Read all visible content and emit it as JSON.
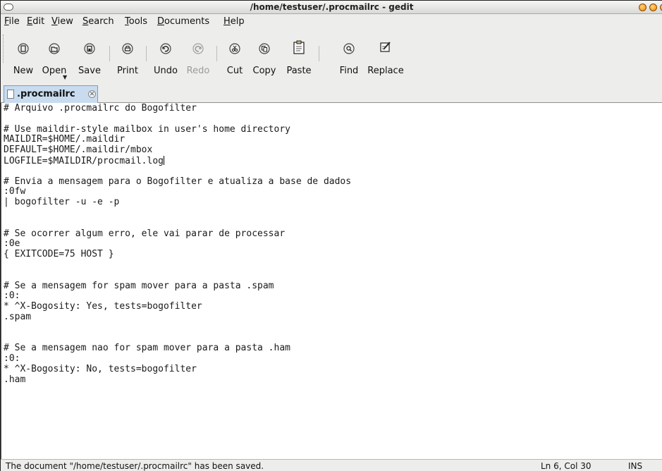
{
  "window": {
    "title": "/home/testuser/.procmailrc - gedit"
  },
  "menubar": {
    "items": [
      {
        "label": "File"
      },
      {
        "label": "Edit"
      },
      {
        "label": "View"
      },
      {
        "label": "Search"
      },
      {
        "label": "Tools"
      },
      {
        "label": "Documents"
      },
      {
        "label": "Help"
      }
    ]
  },
  "toolbar": {
    "buttons": [
      {
        "label": "New",
        "icon": "new-document-icon",
        "enabled": true
      },
      {
        "label": "Open",
        "icon": "open-folder-icon",
        "enabled": true
      },
      {
        "label": "Save",
        "icon": "save-disk-icon",
        "enabled": true
      },
      {
        "label": "Print",
        "icon": "printer-icon",
        "enabled": true
      },
      {
        "label": "Undo",
        "icon": "undo-icon",
        "enabled": true
      },
      {
        "label": "Redo",
        "icon": "redo-icon",
        "enabled": false
      },
      {
        "label": "Cut",
        "icon": "scissors-icon",
        "enabled": true
      },
      {
        "label": "Copy",
        "icon": "copy-icon",
        "enabled": true
      },
      {
        "label": "Paste",
        "icon": "clipboard-icon",
        "enabled": true
      },
      {
        "label": "Find",
        "icon": "magnifier-icon",
        "enabled": true
      },
      {
        "label": "Replace",
        "icon": "replace-icon",
        "enabled": true
      }
    ]
  },
  "tabs": [
    {
      "label": ".procmailrc",
      "active": true
    }
  ],
  "editor": {
    "lines": [
      "# Arquivo .procmailrc do Bogofilter",
      "",
      "# Use maildir-style mailbox in user's home directory",
      "MAILDIR=$HOME/.maildir",
      "DEFAULT=$HOME/.maildir/mbox",
      "LOGFILE=$MAILDIR/procmail.log",
      "",
      "# Envia a mensagem para o Bogofilter e atualiza a base de dados",
      ":0fw",
      "| bogofilter -u -e -p",
      "",
      "",
      "# Se ocorrer algum erro, ele vai parar de processar",
      ":0e",
      "{ EXITCODE=75 HOST }",
      "",
      "",
      "# Se a mensagem for spam mover para a pasta .spam",
      ":0:",
      "* ^X-Bogosity: Yes, tests=bogofilter",
      ".spam",
      "",
      "",
      "# Se a mensagem nao for spam mover para a pasta .ham",
      ":0:",
      "* ^X-Bogosity: No, tests=bogofilter",
      ".ham"
    ],
    "caret_line": 6,
    "caret_col": 30
  },
  "statusbar": {
    "message": "The document \"/home/testuser/.procmailrc\" has been saved.",
    "position": "Ln 6, Col 30",
    "mode": "INS"
  },
  "colors": {
    "tab_active": "#c9dcef",
    "window_bg": "#ededeb",
    "wm_button": "#f08a00"
  }
}
